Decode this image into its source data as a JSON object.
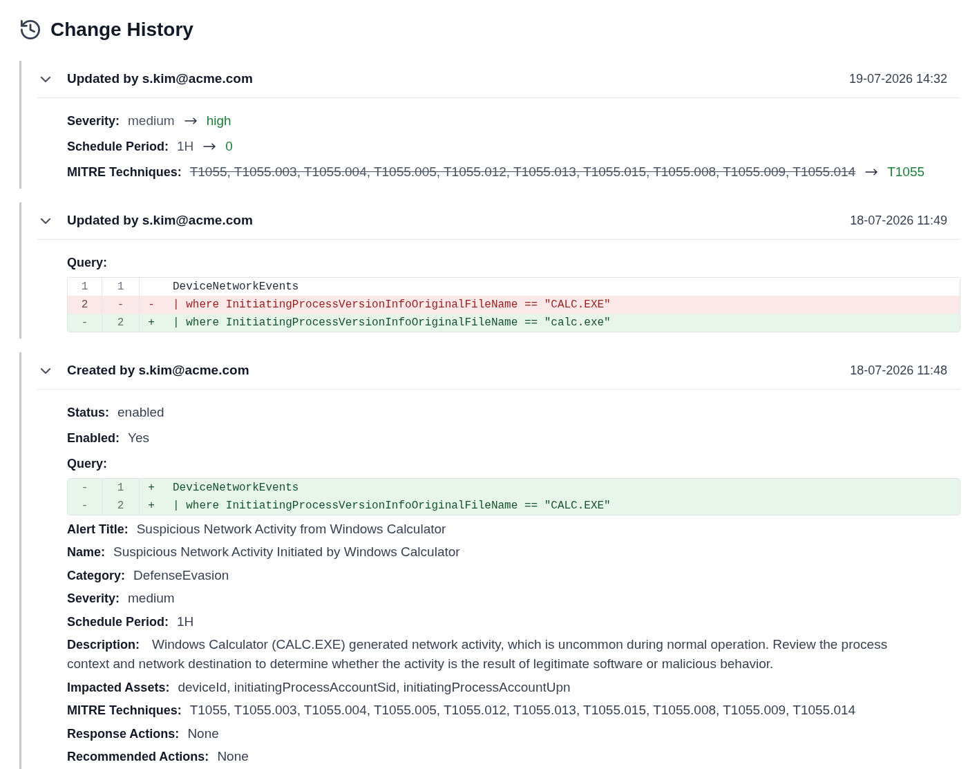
{
  "title": "Change History",
  "entries": [
    {
      "title": "Updated by s.kim@acme.com",
      "timestamp": "19-07-2026 14:32",
      "expanded": true,
      "fields": [
        {
          "kind": "change",
          "label": "Severity:",
          "old": "medium",
          "new": "high",
          "strikethrough": false
        },
        {
          "kind": "change",
          "label": "Schedule Period:",
          "old": "1H",
          "new": "0",
          "strikethrough": false
        },
        {
          "kind": "change",
          "label": "MITRE Techniques:",
          "old": "T1055, T1055.003, T1055.004, T1055.005, T1055.012, T1055.013, T1055.015, T1055.008, T1055.009, T1055.014",
          "new": "T1055",
          "strikethrough": true
        }
      ]
    },
    {
      "title": "Updated by s.kim@acme.com",
      "timestamp": "18-07-2026 11:49",
      "expanded": true,
      "fields": [
        {
          "kind": "diff",
          "label": "Query:",
          "lines": [
            {
              "kind": "context",
              "old": "1",
              "new": "1",
              "code": "DeviceNetworkEvents"
            },
            {
              "kind": "removed",
              "old": "2",
              "new": "-",
              "sign": "-",
              "code": "| where InitiatingProcessVersionInfoOriginalFileName == \"CALC.EXE\""
            },
            {
              "kind": "added",
              "old": "-",
              "new": "2",
              "sign": "+",
              "code": "| where InitiatingProcessVersionInfoOriginalFileName == \"calc.exe\""
            }
          ]
        }
      ]
    },
    {
      "title": "Created by s.kim@acme.com",
      "timestamp": "18-07-2026 11:48",
      "expanded": true,
      "fields": [
        {
          "kind": "text",
          "label": "Status:",
          "value": "enabled"
        },
        {
          "kind": "text",
          "label": "Enabled:",
          "value": "Yes"
        },
        {
          "kind": "diff",
          "label": "Query:",
          "lines": [
            {
              "kind": "added",
              "old": "-",
              "new": "1",
              "sign": "+",
              "code": "DeviceNetworkEvents"
            },
            {
              "kind": "added",
              "old": "-",
              "new": "2",
              "sign": "+",
              "code": "| where InitiatingProcessVersionInfoOriginalFileName == \"CALC.EXE\""
            }
          ]
        },
        {
          "kind": "text",
          "label": "Alert Title:",
          "value": "Suspicious Network Activity from Windows Calculator"
        },
        {
          "kind": "text",
          "label": "Name:",
          "value": "Suspicious Network Activity Initiated by Windows Calculator"
        },
        {
          "kind": "text",
          "label": "Category:",
          "value": "DefenseEvasion"
        },
        {
          "kind": "text",
          "label": "Severity:",
          "value": "medium"
        },
        {
          "kind": "text",
          "label": "Schedule Period:",
          "value": "1H"
        },
        {
          "kind": "paragraph",
          "label": "Description:",
          "value": "Windows Calculator (CALC.EXE) generated network activity, which is uncommon during normal operation. Review the process context and network destination to determine whether the activity is the result of legitimate software or malicious behavior."
        },
        {
          "kind": "text",
          "label": "Impacted Assets:",
          "value": "deviceId, initiatingProcessAccountSid, initiatingProcessAccountUpn"
        },
        {
          "kind": "text",
          "label": "MITRE Techniques:",
          "value": "T1055, T1055.003, T1055.004, T1055.005, T1055.012, T1055.013, T1055.015, T1055.008, T1055.009, T1055.014"
        },
        {
          "kind": "text",
          "label": "Response Actions:",
          "value": "None"
        },
        {
          "kind": "text",
          "label": "Recommended Actions:",
          "value": "None"
        }
      ]
    }
  ]
}
